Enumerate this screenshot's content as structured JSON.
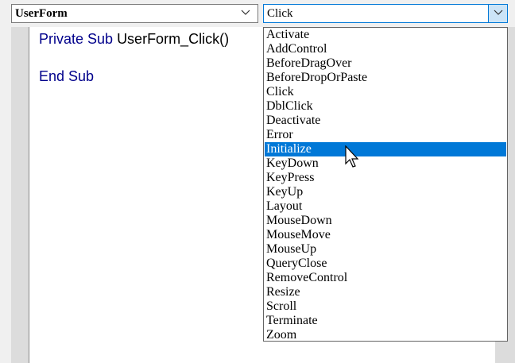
{
  "object_combo": {
    "value": "UserForm"
  },
  "procedure_combo": {
    "value": "Click"
  },
  "code": {
    "line1_keywords": "Private Sub ",
    "line1_name": "UserForm_Click()",
    "line2": "End Sub"
  },
  "dropdown": {
    "selected": "Initialize",
    "items": [
      "Activate",
      "AddControl",
      "BeforeDragOver",
      "BeforeDropOrPaste",
      "Click",
      "DblClick",
      "Deactivate",
      "Error",
      "Initialize",
      "KeyDown",
      "KeyPress",
      "KeyUp",
      "Layout",
      "MouseDown",
      "MouseMove",
      "MouseUp",
      "QueryClose",
      "RemoveControl",
      "Resize",
      "Scroll",
      "Terminate",
      "Zoom"
    ]
  },
  "colors": {
    "selection": "#0078d7",
    "keyword": "#00008b",
    "combo_button": "#cce4f7"
  }
}
